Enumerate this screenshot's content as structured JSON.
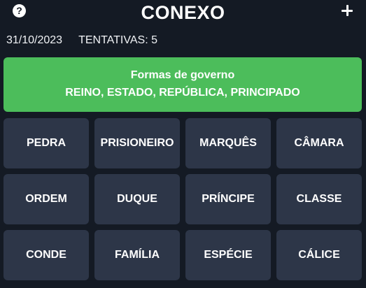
{
  "header": {
    "title": "CONEXO",
    "help_icon": "question-circle-icon",
    "help_glyph": "?",
    "add_icon": "plus-icon"
  },
  "meta": {
    "date": "31/10/2023",
    "attempts": "TENTATIVAS: 5"
  },
  "solved_group": {
    "category": "Formas de governo",
    "words": "REINO, ESTADO, REPÚBLICA, PRINCIPADO",
    "color": "#4cbd5b"
  },
  "board": {
    "tiles": [
      "PEDRA",
      "PRISIONEIRO",
      "MARQUÊS",
      "CÂMARA",
      "ORDEM",
      "DUQUE",
      "PRÍNCIPE",
      "CLASSE",
      "CONDE",
      "FAMÍLIA",
      "ESPÉCIE",
      "CÁLICE"
    ],
    "tile_color": "#2d3648"
  },
  "colors": {
    "background": "#141a24",
    "text": "#ffffff"
  }
}
